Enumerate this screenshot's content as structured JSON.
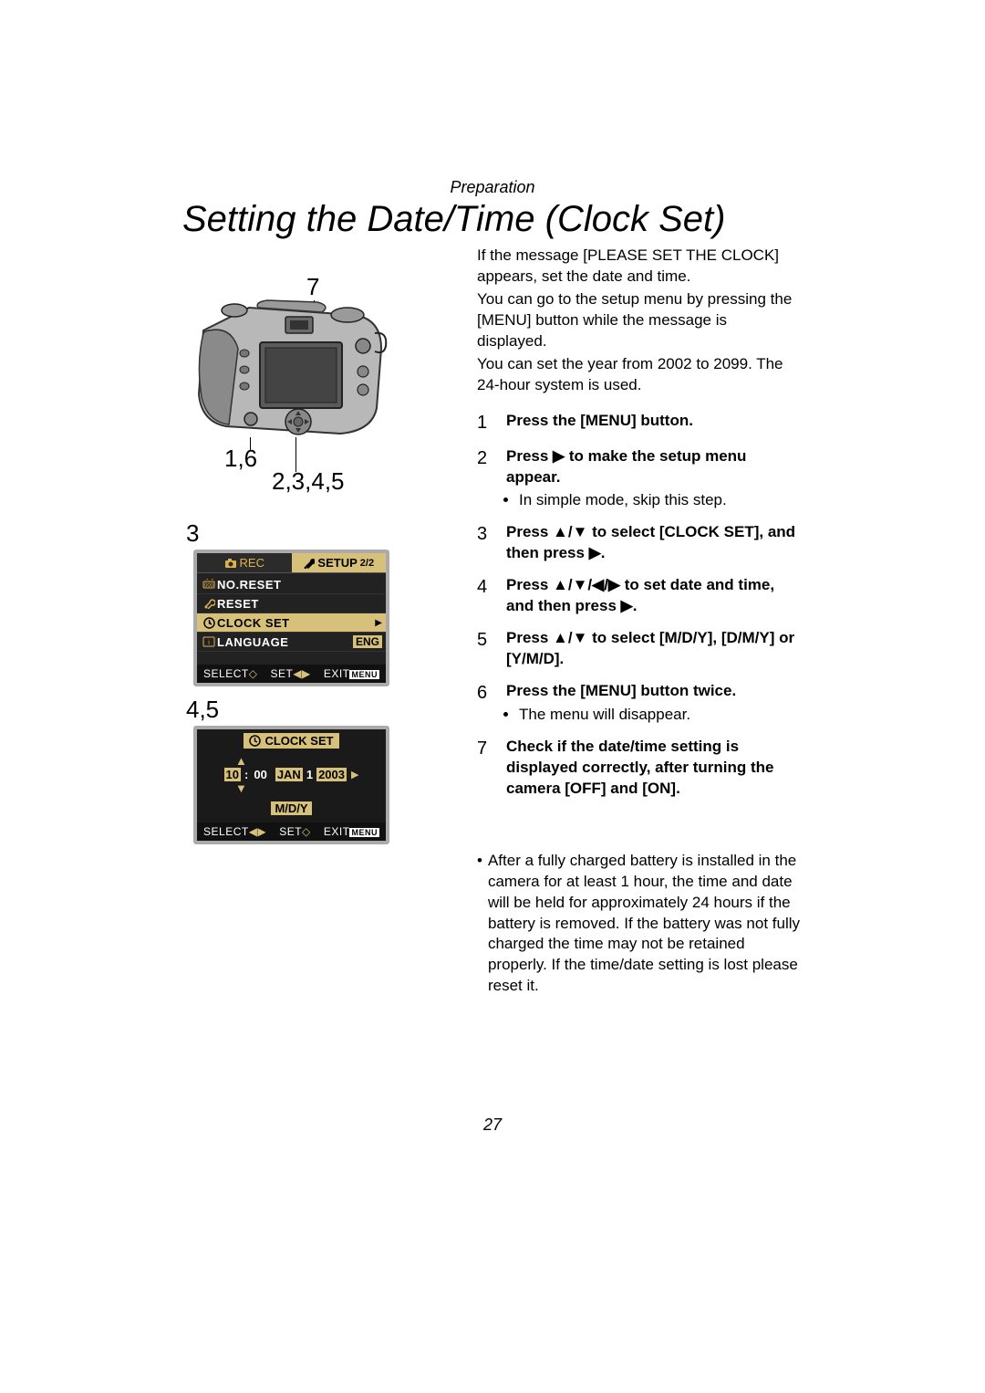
{
  "section": "Preparation",
  "title": "Setting the Date/Time (Clock Set)",
  "callouts": {
    "top": "7",
    "bottomLeft": "1,6",
    "bottomRight": "2,3,4,5"
  },
  "lcd1_label": "3",
  "lcd1": {
    "tab_rec": "REC",
    "tab_setup": "SETUP",
    "tab_page": "2/2",
    "rows": [
      {
        "label": "NO.RESET",
        "val": "",
        "selected": false
      },
      {
        "label": "RESET",
        "val": "",
        "selected": false
      },
      {
        "label": "CLOCK SET",
        "val": "",
        "selected": true,
        "arrow": true
      },
      {
        "label": "LANGUAGE",
        "val": "ENG",
        "selected": false
      }
    ],
    "footer_select": "SELECT",
    "footer_set": "SET",
    "footer_exit": "EXIT",
    "footer_menu": "MENU"
  },
  "lcd2_label": "4,5",
  "lcd2": {
    "title": "CLOCK SET",
    "hh": "10",
    "colon": ":",
    "mm": "00",
    "mon": "JAN",
    "day": "1",
    "year": "2003",
    "format": "M/D/Y",
    "footer_select": "SELECT",
    "footer_set": "SET",
    "footer_exit": "EXIT",
    "footer_menu": "MENU"
  },
  "intro": {
    "p1": "If the message [PLEASE SET THE CLOCK] appears, set the date and time.",
    "p2": "You can go to the setup menu by pressing the [MENU] button while the message is displayed.",
    "p3": "You can set the year from 2002 to 2099. The 24-hour system is used."
  },
  "steps": [
    {
      "n": "1",
      "bold": "Press the [MENU] button."
    },
    {
      "n": "2",
      "bold": "Press ▶ to make the setup menu appear.",
      "bullet": "In simple mode, skip this step."
    },
    {
      "n": "3",
      "bold": "Press ▲/▼ to select [CLOCK SET], and then press ▶."
    },
    {
      "n": "4",
      "bold": "Press ▲/▼/◀/▶ to set date and time, and then press ▶."
    },
    {
      "n": "5",
      "bold": "Press ▲/▼ to select [M/D/Y], [D/M/Y] or [Y/M/D]."
    },
    {
      "n": "6",
      "bold": "Press the [MENU] button twice.",
      "bullet": "The menu will disappear."
    },
    {
      "n": "7",
      "bold": "Check if the date/time setting is displayed correctly, after turning the camera [OFF] and [ON]."
    }
  ],
  "note": "After a fully charged battery is installed in the camera for at least 1 hour, the time and date will be held for approximately 24 hours if the battery is removed. If the battery was not fully charged the time may not be retained properly. If the time/date setting is lost please reset it.",
  "page_number": "27"
}
